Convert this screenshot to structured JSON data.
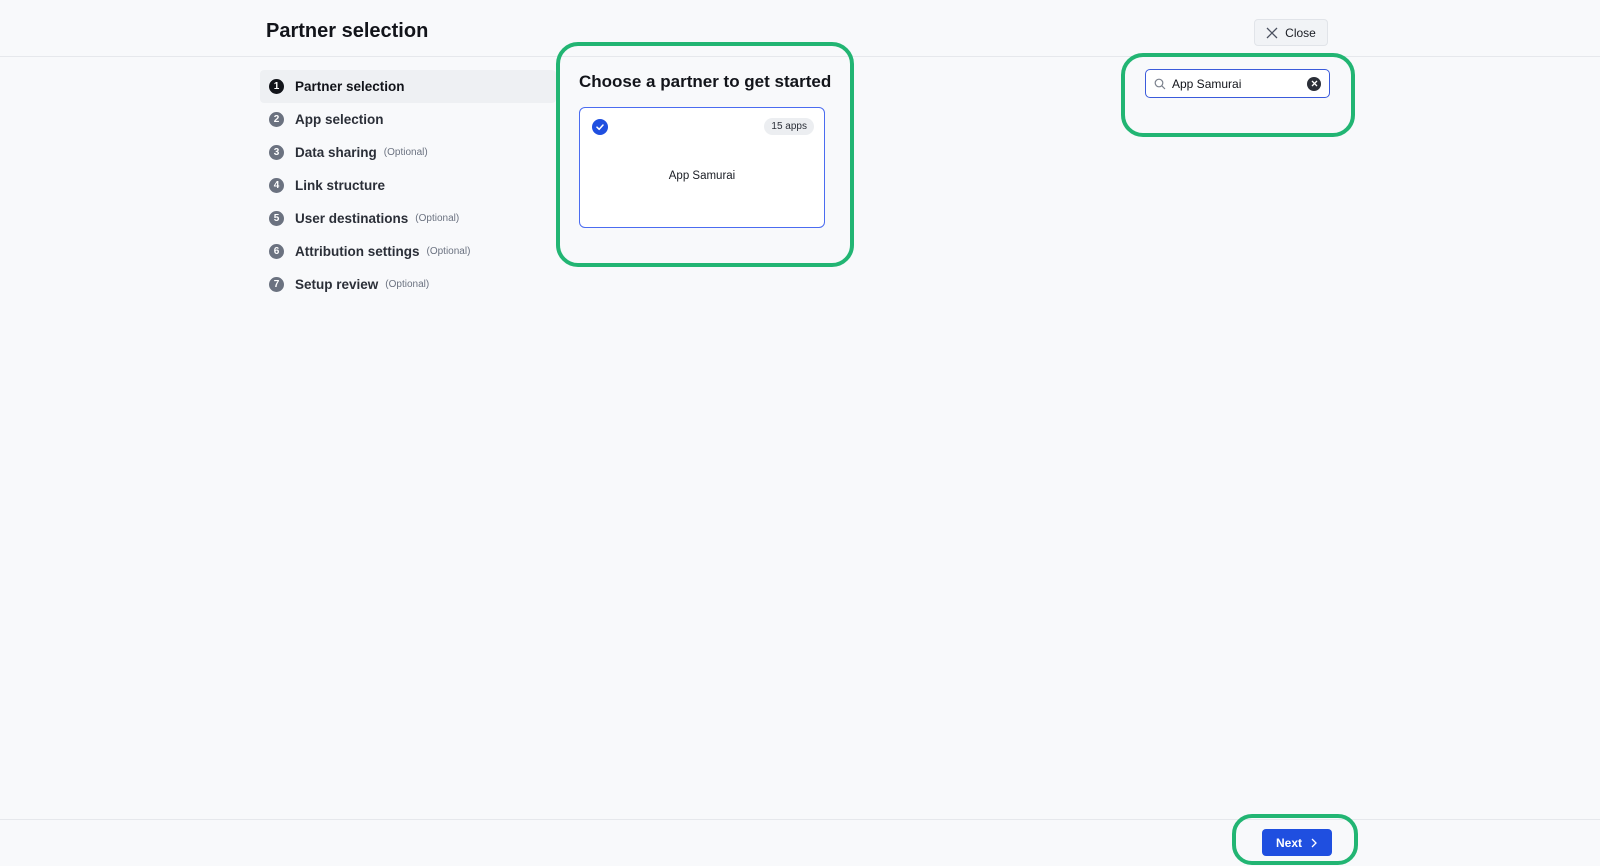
{
  "header": {
    "title": "Partner selection",
    "close_label": "Close"
  },
  "steps": [
    {
      "num": "1",
      "label": "Partner selection",
      "optional": ""
    },
    {
      "num": "2",
      "label": "App selection",
      "optional": ""
    },
    {
      "num": "3",
      "label": "Data sharing",
      "optional": "(Optional)"
    },
    {
      "num": "4",
      "label": "Link structure",
      "optional": ""
    },
    {
      "num": "5",
      "label": "User destinations",
      "optional": "(Optional)"
    },
    {
      "num": "6",
      "label": "Attribution settings",
      "optional": "(Optional)"
    },
    {
      "num": "7",
      "label": "Setup review",
      "optional": "(Optional)"
    }
  ],
  "main": {
    "title": "Choose a partner to get started",
    "partner_card": {
      "name": "App Samurai",
      "apps_badge": "15 apps",
      "selected": true
    }
  },
  "search": {
    "value": "App Samurai",
    "icon": "search-icon",
    "clear_icon": "clear-icon"
  },
  "footer": {
    "next_label": "Next"
  },
  "colors": {
    "accent": "#1f4fe0",
    "highlight": "#22b573",
    "background": "#f8f9fb"
  }
}
